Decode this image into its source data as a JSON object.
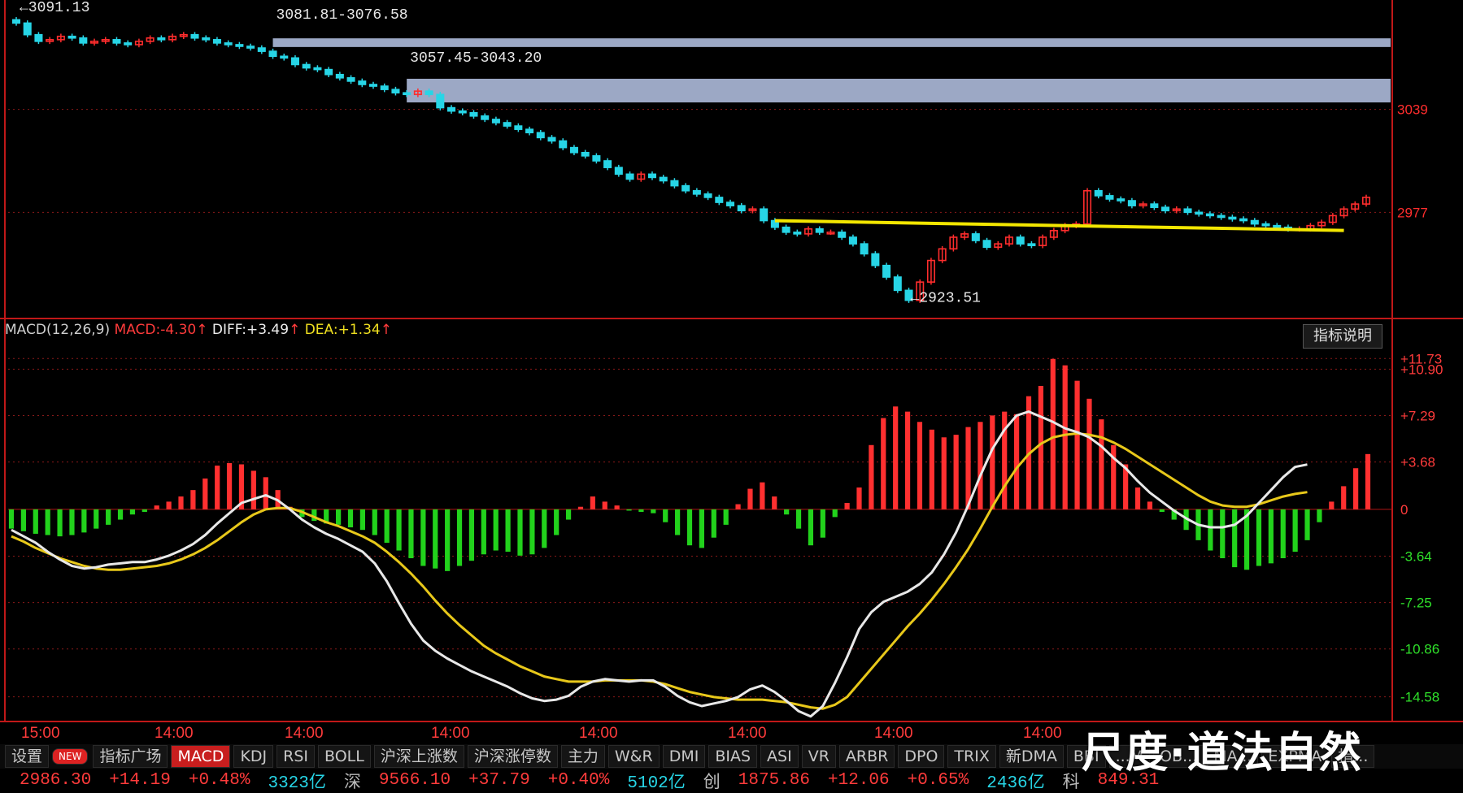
{
  "price_panel": {
    "annotations": {
      "high_label": "3091.13",
      "gap1_label": "3081.81-3076.58",
      "gap2_label": "3057.45-3043.20",
      "low_label": "2923.51"
    },
    "right_ticks": [
      "3039",
      "2977"
    ]
  },
  "macd_panel": {
    "indicator_name": "MACD(12,26,9)",
    "macd_label": "MACD:",
    "macd_value": "-4.30",
    "diff_label": "DIFF:",
    "diff_value": "+3.49",
    "dea_label": "DEA:",
    "dea_value": "+1.34",
    "help_button": "指标说明",
    "right_ticks": [
      "+11.73",
      "+10.90",
      "+7.29",
      "+3.68",
      "0",
      "-3.64",
      "-7.25",
      "-10.86",
      "-14.58"
    ]
  },
  "time_labels": [
    "15:00",
    "14:00",
    "14:00",
    "14:00",
    "14:00",
    "14:00",
    "14:00",
    "14:00"
  ],
  "tabs": [
    "设置",
    "NEW",
    "指标广场",
    "MACD",
    "KDJ",
    "RSI",
    "BOLL",
    "沪深上涨数",
    "沪深涨停数",
    "主力",
    "W&R",
    "DMI",
    "BIAS",
    "ASI",
    "VR",
    "ARBR",
    "DPO",
    "TRIX",
    "新DMA",
    "BBI",
    "...M",
    "OB...",
    "MA...",
    "EXPMA",
    "指..."
  ],
  "status": {
    "sh_index": "2986.30",
    "sh_change": "+14.19",
    "sh_pct": "+0.48%",
    "sh_amount": "3323亿",
    "sz_label": "深",
    "sz_index": "9566.10",
    "sz_change": "+37.79",
    "sz_pct": "+0.40%",
    "sz_amount": "5102亿",
    "cy_label": "创",
    "cy_index": "1875.86",
    "cy_change": "+12.06",
    "cy_pct": "+0.65%",
    "cy_amount": "2436亿",
    "kc_label": "科",
    "kc_index": "849.31"
  },
  "watermark": "尺度·道法自然",
  "colors": {
    "up": "#ff2d2d",
    "down": "#27d5e6",
    "macd_up_bar": "#ff3030",
    "macd_down_bar": "#22d21c",
    "diff_line": "#e8e8e8",
    "dea_line": "#e8c81a",
    "support_line": "#f2e600",
    "gap_box": "#a9b6d6",
    "grid": "#8a1a1a"
  },
  "chart_data": [
    {
      "type": "candlestick",
      "title": "",
      "y_range": [
        2915,
        3100
      ],
      "close": [
        3091,
        3084,
        3080,
        3081,
        3083,
        3082,
        3079,
        3080,
        3081,
        3079,
        3078,
        3080,
        3082,
        3081,
        3083,
        3084,
        3082,
        3081,
        3079,
        3078,
        3077,
        3076,
        3074,
        3071,
        3070,
        3066,
        3064,
        3063,
        3060,
        3058,
        3056,
        3054,
        3053,
        3051,
        3049,
        3048,
        3050,
        3048,
        3040,
        3038,
        3037,
        3035,
        3033,
        3031,
        3029,
        3027,
        3025,
        3022,
        3020,
        3016,
        3013,
        3011,
        3008,
        3004,
        3000,
        2997,
        3000,
        2998,
        2996,
        2993,
        2990,
        2988,
        2986,
        2983,
        2981,
        2978,
        2979,
        2972,
        2968,
        2965,
        2964,
        2967,
        2965,
        2965,
        2962,
        2958,
        2952,
        2945,
        2938,
        2930,
        2924,
        2935,
        2948,
        2955,
        2962,
        2964,
        2960,
        2956,
        2958,
        2962,
        2958,
        2957,
        2962,
        2966,
        2969,
        2970,
        2990,
        2987,
        2985,
        2984,
        2981,
        2982,
        2980,
        2978,
        2979,
        2977,
        2976,
        2975,
        2974,
        2973,
        2972,
        2970,
        2969,
        2968,
        2967,
        2967,
        2969,
        2971,
        2975,
        2979,
        2982,
        2986
      ],
      "annotations": [
        "3091.13",
        "3081.81-3076.58",
        "3057.45-3043.20",
        "2923.51"
      ],
      "gaps": [
        [
          3076.58,
          3081.81
        ],
        [
          3043.2,
          3057.45
        ]
      ],
      "support_level": 2971,
      "right_ticks": [
        3039,
        2977
      ]
    },
    {
      "type": "macd",
      "title": "MACD(12,26,9)",
      "y_range": [
        -16.5,
        13.2
      ],
      "ticks": [
        11.73,
        10.9,
        7.29,
        3.68,
        0,
        -3.64,
        -7.25,
        -10.86,
        -14.58
      ],
      "macd_hist": [
        -1.5,
        -1.7,
        -1.9,
        -2.0,
        -2.1,
        -2.0,
        -1.8,
        -1.5,
        -1.2,
        -0.8,
        -0.4,
        -0.2,
        0.3,
        0.6,
        1.0,
        1.5,
        2.4,
        3.4,
        3.6,
        3.5,
        3.0,
        2.5,
        1.5,
        0.2,
        -0.6,
        -0.9,
        -1.1,
        -1.2,
        -1.4,
        -1.6,
        -2.0,
        -2.6,
        -3.2,
        -3.8,
        -4.4,
        -4.6,
        -4.8,
        -4.4,
        -4.0,
        -3.5,
        -3.2,
        -3.3,
        -3.6,
        -3.5,
        -3.0,
        -2.0,
        -0.8,
        0.2,
        1.0,
        0.6,
        0.3,
        -0.1,
        -0.2,
        -0.3,
        -1.0,
        -2.0,
        -2.8,
        -3.0,
        -2.2,
        -1.2,
        0.4,
        1.6,
        2.1,
        1.0,
        -0.4,
        -1.5,
        -2.8,
        -2.2,
        -0.6,
        0.5,
        1.7,
        5.0,
        7.1,
        8.0,
        7.6,
        6.8,
        6.2,
        5.6,
        5.8,
        6.4,
        6.8,
        7.3,
        7.6,
        7.4,
        8.8,
        9.6,
        11.7,
        11.2,
        10.0,
        8.6,
        7.0,
        5.0,
        3.5,
        1.7,
        0.6,
        -0.2,
        -0.8,
        -1.6,
        -2.4,
        -3.2,
        -3.8,
        -4.5,
        -4.7,
        -4.4,
        -4.2,
        -3.8,
        -3.3,
        -2.4,
        -1.0,
        0.6,
        1.8,
        3.2,
        4.3
      ],
      "diff": [
        -1.6,
        -2.1,
        -2.6,
        -3.3,
        -3.9,
        -4.4,
        -4.6,
        -4.5,
        -4.3,
        -4.2,
        -4.1,
        -4.1,
        -3.9,
        -3.6,
        -3.2,
        -2.7,
        -2.0,
        -1.1,
        -0.3,
        0.5,
        0.8,
        1.1,
        0.7,
        0.0,
        -0.8,
        -1.4,
        -1.9,
        -2.3,
        -2.8,
        -3.3,
        -4.2,
        -5.6,
        -7.3,
        -8.9,
        -10.2,
        -11.0,
        -11.6,
        -12.1,
        -12.6,
        -13.0,
        -13.4,
        -13.8,
        -14.3,
        -14.7,
        -14.9,
        -14.8,
        -14.5,
        -13.8,
        -13.4,
        -13.2,
        -13.3,
        -13.4,
        -13.3,
        -13.3,
        -13.8,
        -14.5,
        -15.0,
        -15.3,
        -15.1,
        -14.9,
        -14.6,
        -14.0,
        -13.7,
        -14.2,
        -14.9,
        -15.7,
        -16.1,
        -15.3,
        -13.5,
        -11.5,
        -9.3,
        -8.0,
        -7.2,
        -6.8,
        -6.4,
        -5.8,
        -4.9,
        -3.5,
        -1.8,
        0.3,
        2.6,
        4.7,
        6.2,
        7.3,
        7.6,
        7.2,
        6.8,
        6.3,
        6.0,
        5.6,
        4.9,
        4.0,
        3.2,
        2.2,
        1.3,
        0.6,
        -0.1,
        -0.7,
        -1.2,
        -1.4,
        -1.4,
        -1.2,
        -0.5,
        0.5,
        1.5,
        2.5,
        3.3,
        3.49
      ],
      "dea": [
        -2.1,
        -2.5,
        -3.0,
        -3.4,
        -3.8,
        -4.1,
        -4.4,
        -4.6,
        -4.7,
        -4.7,
        -4.6,
        -4.5,
        -4.4,
        -4.2,
        -3.9,
        -3.5,
        -3.0,
        -2.4,
        -1.7,
        -1.0,
        -0.4,
        0.0,
        0.1,
        0.1,
        -0.2,
        -0.6,
        -1.0,
        -1.3,
        -1.7,
        -2.1,
        -2.6,
        -3.3,
        -4.1,
        -5.0,
        -6.0,
        -7.1,
        -8.1,
        -9.0,
        -9.8,
        -10.6,
        -11.2,
        -11.7,
        -12.2,
        -12.6,
        -13.0,
        -13.2,
        -13.4,
        -13.4,
        -13.4,
        -13.3,
        -13.3,
        -13.3,
        -13.3,
        -13.4,
        -13.6,
        -13.9,
        -14.2,
        -14.4,
        -14.6,
        -14.7,
        -14.8,
        -14.8,
        -14.8,
        -14.9,
        -15.0,
        -15.2,
        -15.4,
        -15.5,
        -15.2,
        -14.6,
        -13.5,
        -12.4,
        -11.3,
        -10.2,
        -9.1,
        -8.1,
        -7.0,
        -5.8,
        -4.5,
        -3.1,
        -1.5,
        0.2,
        1.8,
        3.2,
        4.3,
        5.1,
        5.6,
        5.8,
        5.9,
        5.8,
        5.6,
        5.2,
        4.7,
        4.1,
        3.5,
        2.9,
        2.3,
        1.7,
        1.1,
        0.6,
        0.3,
        0.2,
        0.2,
        0.4,
        0.7,
        1.0,
        1.2,
        1.34
      ]
    }
  ]
}
